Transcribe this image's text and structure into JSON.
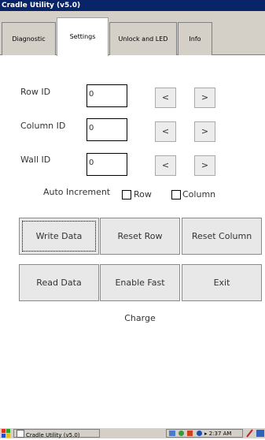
{
  "window": {
    "title": "Cradle Utility (v5.0)"
  },
  "tabs": [
    {
      "label": "Diagnostic"
    },
    {
      "label": "Settings"
    },
    {
      "label": "Unlock and LED"
    },
    {
      "label": "Info"
    }
  ],
  "settings": {
    "row_id_label": "Row ID",
    "row_id_value": "0",
    "column_id_label": "Column ID",
    "column_id_value": "0",
    "wall_id_label": "Wall ID",
    "wall_id_value": "0",
    "decrement_label": "<",
    "increment_label": ">",
    "auto_increment_label": "Auto Increment",
    "row_checkbox_label": "Row",
    "column_checkbox_label": "Column",
    "row_checked": false,
    "column_checked": false
  },
  "buttons": {
    "write_data": "Write Data",
    "reset_row": "Reset Row",
    "reset_column": "Reset Column",
    "read_data": "Read Data",
    "enable_fast_charge": "Enable Fast Charge",
    "exit": "Exit"
  },
  "taskbar": {
    "app_label": "Cradle Utility (v5.0)",
    "clock": "2:37 AM"
  },
  "colors": {
    "titlebar": "#0a246a",
    "chrome": "#d4d0c8"
  }
}
